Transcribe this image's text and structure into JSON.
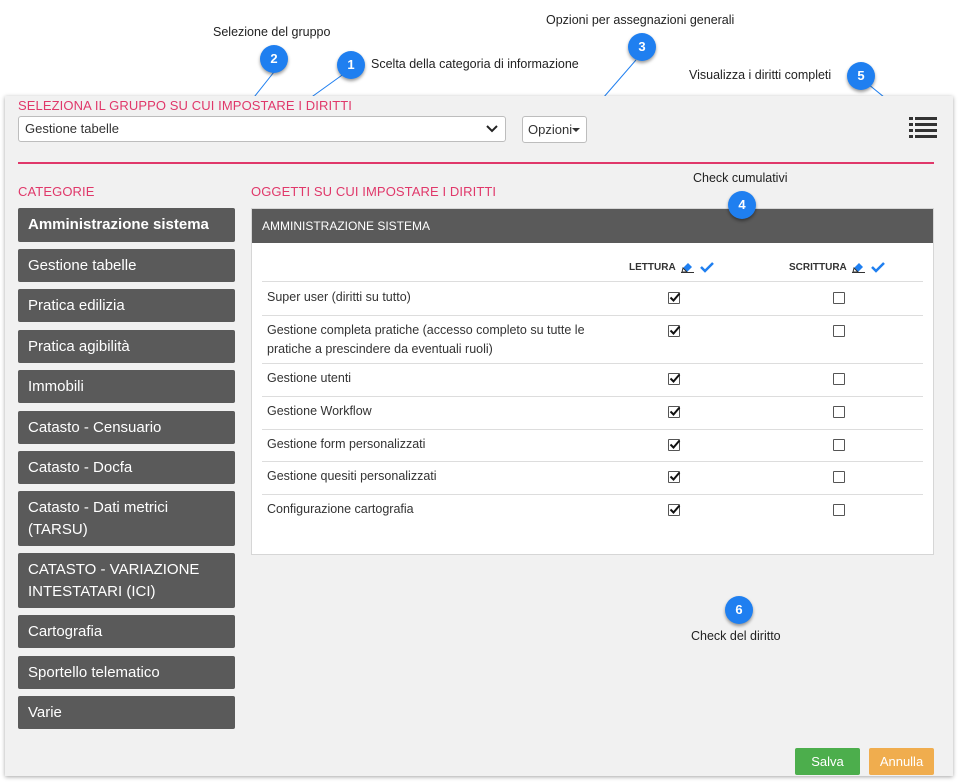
{
  "annotations": {
    "c1": {
      "num": "1",
      "text": "Scelta della categoria di informazione"
    },
    "c2": {
      "num": "2",
      "text": "Selezione del gruppo"
    },
    "c3": {
      "num": "3",
      "text": "Opzioni per assegnazioni generali"
    },
    "c4": {
      "num": "4",
      "text": "Check cumulativi"
    },
    "c5": {
      "num": "5",
      "text": "Visualizza i diritti completi"
    },
    "c6": {
      "num": "6",
      "text": "Check del diritto"
    }
  },
  "header": {
    "group_heading": "SELEZIONA IL GRUPPO SU CUI IMPOSTARE I DIRITTI",
    "group_select_value": "Gestione tabelle",
    "options_label": "Opzioni"
  },
  "categories": {
    "heading": "CATEGORIE",
    "items": [
      {
        "label": "Amministrazione sistema"
      },
      {
        "label": "Gestione tabelle"
      },
      {
        "label": "Pratica edilizia"
      },
      {
        "label": "Pratica agibilità"
      },
      {
        "label": "Immobili"
      },
      {
        "label": "Catasto - Censuario"
      },
      {
        "label": "Catasto - Docfa"
      },
      {
        "label": "Catasto - Dati metrici (TARSU)"
      },
      {
        "label": "CATASTO - VARIAZIONE INTESTATARI (ICI)"
      },
      {
        "label": "Cartografia"
      },
      {
        "label": "Sportello telematico"
      },
      {
        "label": "Varie"
      }
    ]
  },
  "objects": {
    "heading": "OGGETTI SU CUI IMPOSTARE I DIRITTI",
    "card_title": "AMMINISTRAZIONE SISTEMA",
    "col_read": "LETTURA",
    "col_write": "SCRITTURA",
    "rows": [
      {
        "label": "Super user (diritti su tutto)",
        "read": true,
        "write": false
      },
      {
        "label": "Gestione completa pratiche (accesso completo su tutte le pratiche a prescindere da eventuali ruoli)",
        "read": true,
        "write": false
      },
      {
        "label": "Gestione utenti",
        "read": true,
        "write": false
      },
      {
        "label": "Gestione Workflow",
        "read": true,
        "write": false
      },
      {
        "label": "Gestione form personalizzati",
        "read": true,
        "write": false
      },
      {
        "label": "Gestione quesiti personalizzati",
        "read": true,
        "write": false
      },
      {
        "label": "Configurazione cartografia",
        "read": true,
        "write": false
      }
    ]
  },
  "footer": {
    "save_label": "Salva",
    "cancel_label": "Annulla"
  },
  "colors": {
    "accent_red": "#e0386a",
    "callout_blue": "#1f7ff0",
    "save_green": "#4cae4c",
    "cancel_orange": "#f0ad4e",
    "category_bg": "#5a5a5a"
  }
}
